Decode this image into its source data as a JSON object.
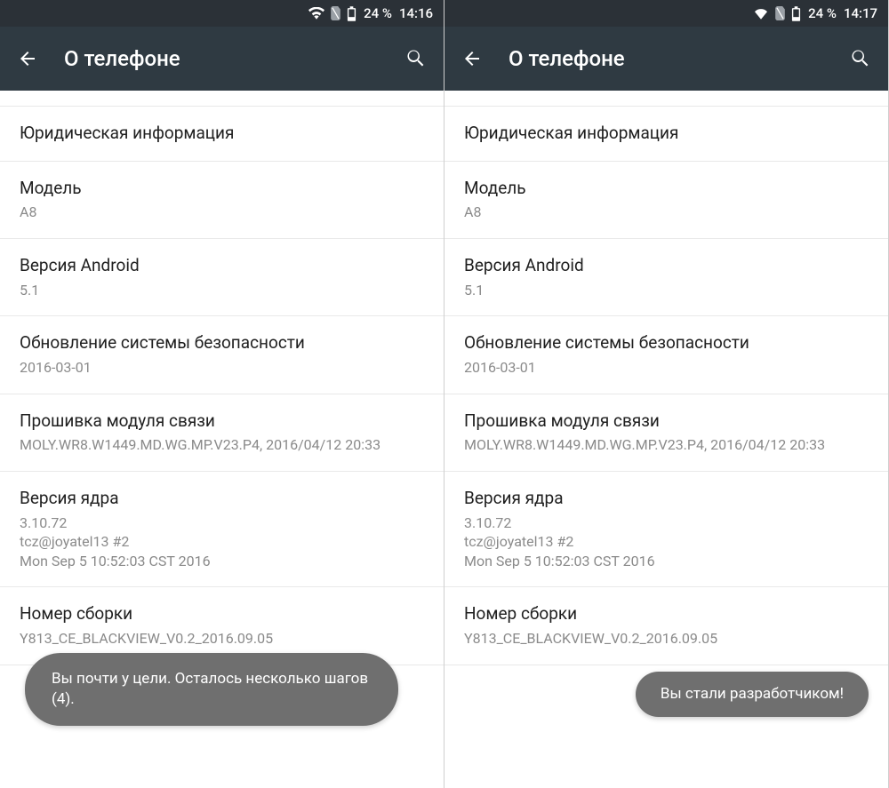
{
  "left": {
    "status": {
      "battery": "24 %",
      "time": "14:16"
    },
    "title": "О телефоне",
    "rows": [
      {
        "primary": "Юридическая информация",
        "secondary": null
      },
      {
        "primary": "Модель",
        "secondary": "A8"
      },
      {
        "primary": "Версия Android",
        "secondary": "5.1"
      },
      {
        "primary": "Обновление системы безопасности",
        "secondary": "2016-03-01"
      },
      {
        "primary": "Прошивка модуля связи",
        "secondary": "MOLY.WR8.W1449.MD.WG.MP.V23.P4, 2016/04/12 20:33"
      },
      {
        "primary": "Версия ядра",
        "secondary": "3.10.72\ntcz@joyatel13 #2\nMon Sep 5 10:52:03 CST 2016"
      },
      {
        "primary": "Номер сборки",
        "secondary": "Y813_CE_BLACKVIEW_V0.2_2016.09.05"
      }
    ],
    "toast": "Вы почти у цели. Осталось несколько шагов (4)."
  },
  "right": {
    "status": {
      "battery": "24 %",
      "time": "14:17"
    },
    "title": "О телефоне",
    "rows": [
      {
        "primary": "Юридическая информация",
        "secondary": null
      },
      {
        "primary": "Модель",
        "secondary": "A8"
      },
      {
        "primary": "Версия Android",
        "secondary": "5.1"
      },
      {
        "primary": "Обновление системы безопасности",
        "secondary": "2016-03-01"
      },
      {
        "primary": "Прошивка модуля связи",
        "secondary": "MOLY.WR8.W1449.MD.WG.MP.V23.P4, 2016/04/12 20:33"
      },
      {
        "primary": "Версия ядра",
        "secondary": "3.10.72\ntcz@joyatel13 #2\nMon Sep 5 10:52:03 CST 2016"
      },
      {
        "primary": "Номер сборки",
        "secondary": "Y813_CE_BLACKVIEW_V0.2_2016.09.05"
      }
    ],
    "toast": "Вы стали разработчиком!"
  }
}
